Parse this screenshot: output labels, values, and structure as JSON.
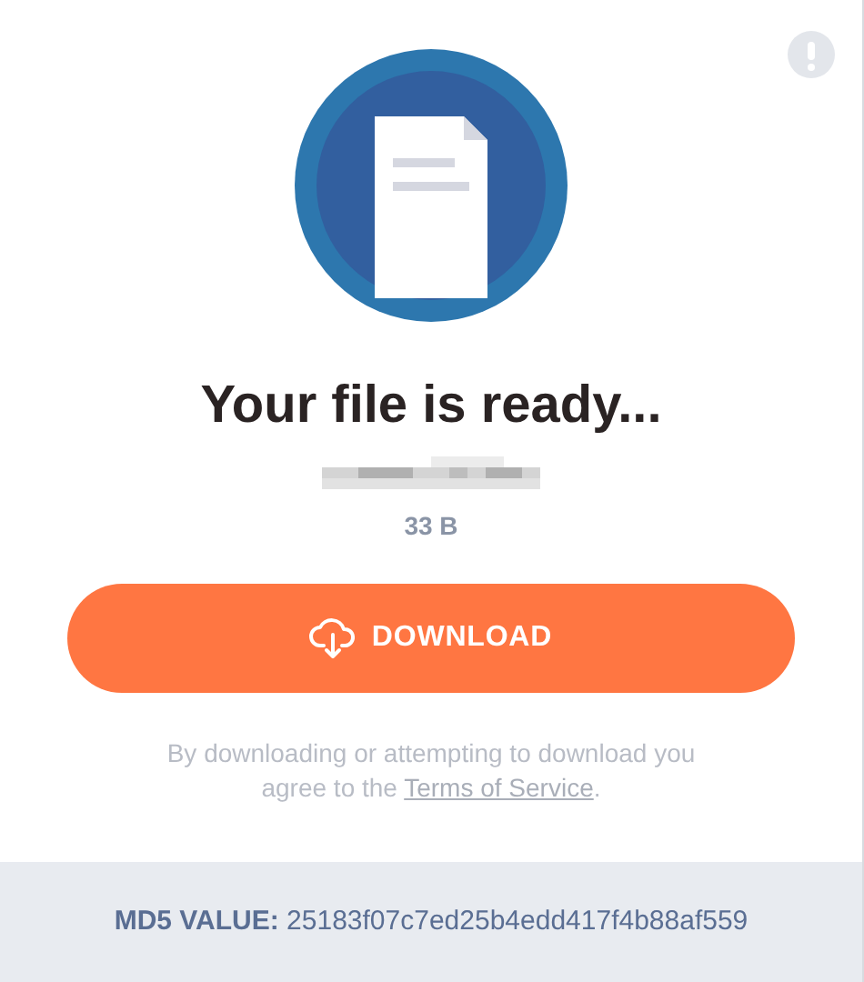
{
  "title": "Your file is ready...",
  "file_size": "33 B",
  "download_button": {
    "label": "DOWNLOAD"
  },
  "terms": {
    "before": "By downloading or attempting to download you agree to the ",
    "link": "Terms of Service",
    "after": "."
  },
  "md5": {
    "label": "MD5 VALUE:",
    "value": "25183f07c7ed25b4edd417f4b88af559"
  }
}
